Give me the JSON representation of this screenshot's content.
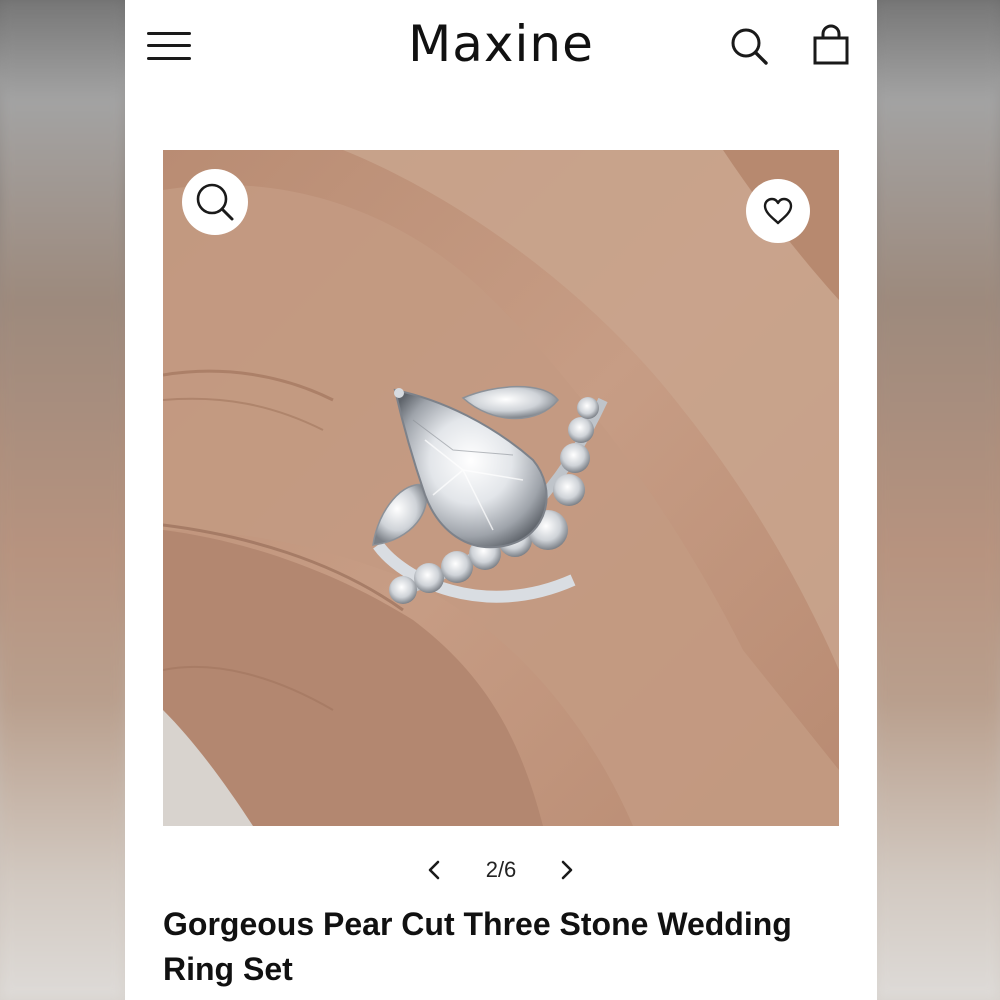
{
  "header": {
    "brand": "Maxine",
    "menu_icon": "hamburger-menu-icon",
    "search_icon": "search-icon",
    "bag_icon": "shopping-bag-icon"
  },
  "gallery": {
    "image_subject": "pear cut three stone wedding ring set on hand",
    "zoom_icon": "magnifier-icon",
    "wishlist_icon": "heart-icon"
  },
  "pager": {
    "current": "2/6",
    "prev_icon": "chevron-left-icon",
    "next_icon": "chevron-right-icon"
  },
  "product": {
    "title": "Gorgeous Pear Cut Three Stone Wedding Ring Set"
  },
  "colors": {
    "text": "#111111",
    "background": "#ffffff"
  }
}
